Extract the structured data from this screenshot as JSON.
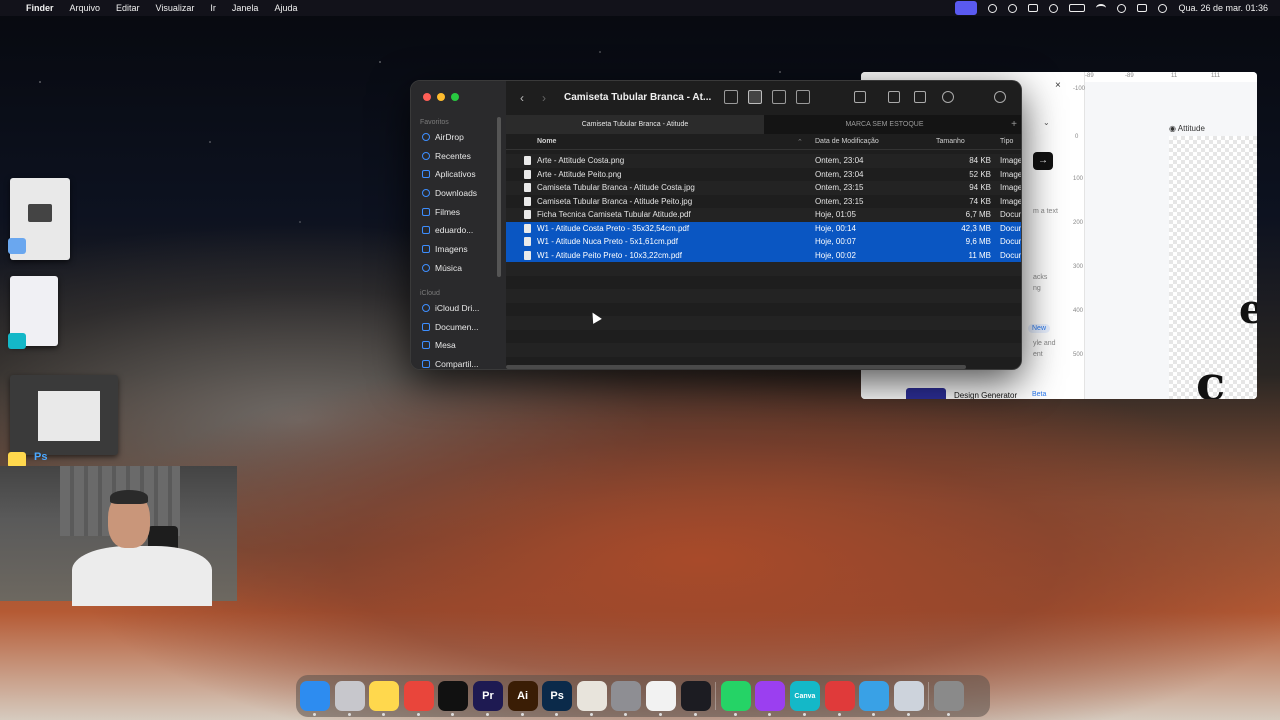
{
  "menubar": {
    "apple": "",
    "app_name": "Finder",
    "menus": [
      "Arquivo",
      "Editar",
      "Visualizar",
      "Ir",
      "Janela",
      "Ajuda"
    ],
    "datetime": "Qua. 26 de mar.  01:36"
  },
  "finder": {
    "title": "Camiseta Tubular Branca - At...",
    "back": "‹",
    "forward": "›",
    "sidebar": {
      "favorites_label": "Favoritos",
      "favorites": [
        "AirDrop",
        "Recentes",
        "Aplicativos",
        "Downloads",
        "Filmes",
        "eduardo...",
        "Imagens",
        "Música"
      ],
      "icloud_label": "iCloud",
      "icloud": [
        "iCloud Dri...",
        "Documen...",
        "Mesa",
        "Compartil..."
      ]
    },
    "tabs": [
      {
        "label": "Camiseta Tubular Branca - Atitude",
        "active": true
      },
      {
        "label": "MARCA SEM ESTOQUE",
        "active": false
      }
    ],
    "tab_add": "+",
    "columns": {
      "name": "Nome",
      "date": "Data de Modificação",
      "size": "Tamanho",
      "type": "Tipo"
    },
    "files": [
      {
        "name": "Arte - Attitude Costa.png",
        "date": "Ontem, 23:04",
        "size": "84 KB",
        "type": "Imagem",
        "selected": false
      },
      {
        "name": "Arte - Attitude Peito.png",
        "date": "Ontem, 23:04",
        "size": "52 KB",
        "type": "Imagem",
        "selected": false
      },
      {
        "name": "Camiseta Tubular Branca - Atitude Costa.jpg",
        "date": "Ontem, 23:15",
        "size": "94 KB",
        "type": "Imagem",
        "selected": false
      },
      {
        "name": "Camiseta Tubular Branca - Atitude Peito.jpg",
        "date": "Ontem, 23:15",
        "size": "74 KB",
        "type": "Imagem",
        "selected": false
      },
      {
        "name": "Ficha Tecnica Camiseta Tubular Atitude.pdf",
        "date": "Hoje, 01:05",
        "size": "6,7 MB",
        "type": "Documento",
        "selected": false
      },
      {
        "name": "W1 - Atitude Costa Preto - 35x32,54cm.pdf",
        "date": "Hoje, 00:14",
        "size": "42,3 MB",
        "type": "Documento",
        "selected": true
      },
      {
        "name": "W1 - Atitude Nuca Preto - 5x1,61cm.pdf",
        "date": "Hoje, 00:07",
        "size": "9,6 MB",
        "type": "Documento",
        "selected": true
      },
      {
        "name": "W1 - Atitude Peito Preto - 10x3,22cm.pdf",
        "date": "Hoje, 00:02",
        "size": "11 MB",
        "type": "Documento",
        "selected": true
      }
    ]
  },
  "canva": {
    "close": "×",
    "layer_label": "Attitude",
    "arrow": "→",
    "ruler_top": [
      "-89",
      "-89",
      "11",
      "111"
    ],
    "ruler_left": [
      "-100",
      "0",
      "100",
      "200",
      "300",
      "400",
      "500"
    ],
    "snippets": [
      "m a text",
      "acks",
      "ng",
      "yle and",
      "ent"
    ],
    "new_badge": "New",
    "design_generator": "Design Generator",
    "beta": "Beta",
    "glyph_a": "c",
    "glyph_b": "e"
  },
  "desktop": {
    "ps_label": "Ps"
  },
  "dock": {
    "items": [
      {
        "name": "finder",
        "label": "",
        "color": "#2d8cf0"
      },
      {
        "name": "launchpad",
        "label": "",
        "color": "#c7c7cc"
      },
      {
        "name": "notes",
        "label": "",
        "color": "#ffd84d"
      },
      {
        "name": "chrome",
        "label": "",
        "color": "#e9453b"
      },
      {
        "name": "capcut",
        "label": "",
        "color": "#111111"
      },
      {
        "name": "premiere",
        "label": "Pr",
        "color": "#1e1a52"
      },
      {
        "name": "illustrator",
        "label": "Ai",
        "color": "#3a1d05"
      },
      {
        "name": "photoshop",
        "label": "Ps",
        "color": "#0b2a4a"
      },
      {
        "name": "adobe-app",
        "label": "",
        "color": "#e8e4dc"
      },
      {
        "name": "system-settings",
        "label": "",
        "color": "#8e8e93"
      },
      {
        "name": "chatgpt",
        "label": "",
        "color": "#f2f2f2"
      },
      {
        "name": "davinci",
        "label": "",
        "color": "#1c1c22"
      },
      {
        "name": "whatsapp",
        "label": "",
        "color": "#25d366"
      },
      {
        "name": "linear-app",
        "label": "",
        "color": "#9b3ff0"
      },
      {
        "name": "canva",
        "label": "Canva",
        "color": "#14b8c8"
      },
      {
        "name": "creative-cloud",
        "label": "",
        "color": "#e03a3a"
      },
      {
        "name": "proxyman",
        "label": "",
        "color": "#39a1e6"
      },
      {
        "name": "preview",
        "label": "",
        "color": "#cdd3dc"
      },
      {
        "name": "trash",
        "label": "",
        "color": "#8a8a8a"
      }
    ]
  }
}
